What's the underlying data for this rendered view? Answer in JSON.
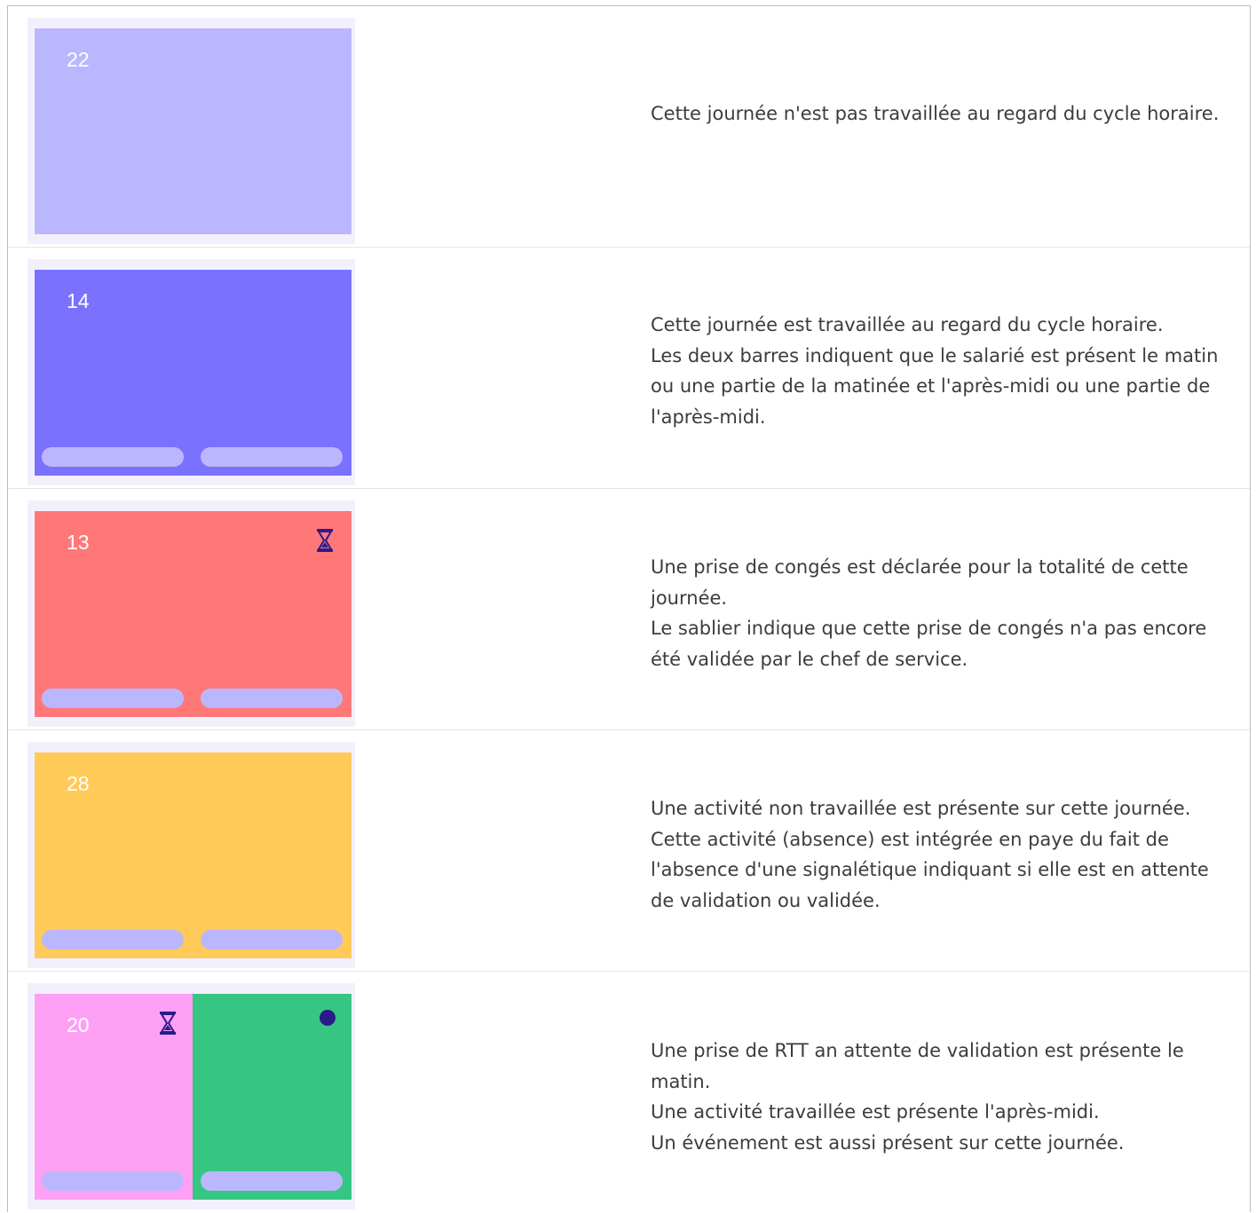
{
  "colors": {
    "tile_frame": "#f3f0fd",
    "not_worked": "#bbb7fe",
    "worked": "#7a71fe",
    "leave": "#ff7877",
    "absence": "#ffca58",
    "rtt": "#fea0f3",
    "worked_activity": "#36c682",
    "half_day_bar": "#bbb7fe",
    "icon_dark": "#2a1b8c"
  },
  "legend": [
    {
      "day": "22",
      "lines": [
        "Cette journée n'est pas travaillée au regard du cycle horaire."
      ]
    },
    {
      "day": "14",
      "lines": [
        "Cette journée est travaillée au regard du cycle horaire.",
        "Les deux barres indiquent que le salarié est présent le matin ou une partie de la matinée et l'après-midi ou une partie de l'après-midi."
      ]
    },
    {
      "day": "13",
      "icon": "hourglass-icon",
      "lines": [
        "Une prise de congés est déclarée pour la totalité de cette journée.",
        "Le sablier indique que cette prise de congés n'a pas encore été validée par le chef de service."
      ]
    },
    {
      "day": "28",
      "lines": [
        "Une activité non travaillée est présente sur cette journée.",
        "Cette activité (absence) est intégrée en paye du fait de l'absence d'une signalétique indiquant si elle est en attente de validation ou validée."
      ]
    },
    {
      "day": "20",
      "icons": [
        "hourglass-icon",
        "event-dot-icon"
      ],
      "lines": [
        "Une prise de RTT an attente de validation est présente le matin.",
        "Une activité travaillée est présente l'après-midi.",
        "Un événement est aussi présent sur cette journée."
      ]
    }
  ]
}
